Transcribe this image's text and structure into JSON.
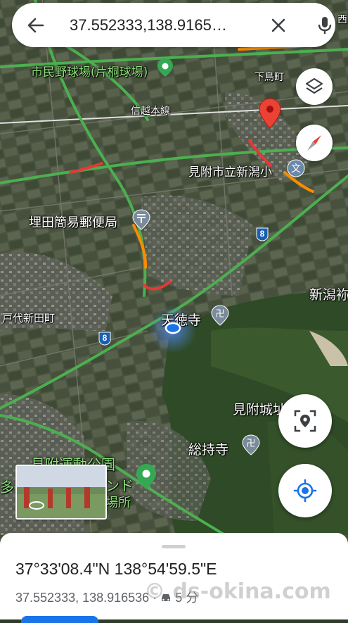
{
  "search": {
    "query": "37.552333,138.9165…"
  },
  "map_labels": {
    "stadium": "市民野球場(片桐球場)",
    "shimotorimachi": "下鳥町",
    "shinetsu_line": "信越本線",
    "school": "見附市立新潟小",
    "post_office": "埋田簡易郵便局",
    "tokudaiji": "天徳寺",
    "todai_shinden": "戸代新田町",
    "niigata_right": "新潟袮",
    "castle": "見附城址",
    "soji_temple": "総持寺",
    "sports_park": "見附運動公園",
    "sports_park_2": "ンド",
    "sports_park_3": "場所",
    "left_edge": "多",
    "top_right_edge": "西",
    "route_8": "8"
  },
  "place_sheet": {
    "dms": "37°33'08.4\"N 138°54'59.5\"E",
    "coords": "37.552333, 138.916536",
    "weather": "5 分",
    "watermark": "© ds-okina.com"
  },
  "icons": {
    "back": "arrow-back-icon",
    "clear": "close-icon",
    "mic": "microphone-icon",
    "layers": "layers-icon",
    "compass": "compass-icon",
    "street_view_scan": "lens-pin-icon",
    "my_location": "my-location-icon",
    "dropped_pin": "red-pin-icon",
    "temple": "manji-icon",
    "post": "post-office-icon",
    "park_pin": "green-pin-icon",
    "school": "school-icon"
  },
  "colors": {
    "traffic_green": "#4caf50",
    "traffic_red": "#e53935",
    "traffic_orange": "#fb8c00",
    "accent_blue": "#1a73e8",
    "pin_red": "#ea4335"
  }
}
